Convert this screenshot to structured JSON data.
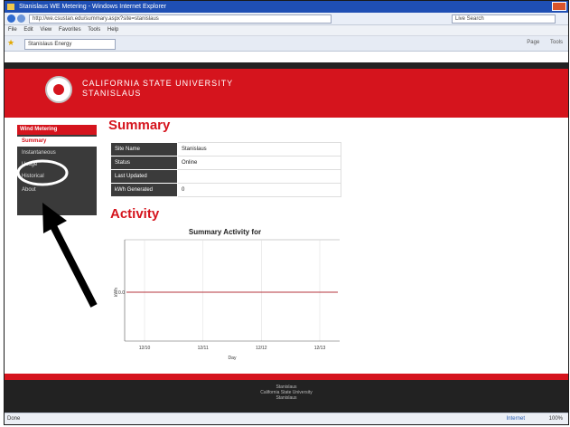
{
  "browser": {
    "title": "Stanislaus WE Metering - Windows Internet Explorer",
    "url": "http://we.csustan.edu/summary.aspx?site=stanislaus",
    "search_placeholder": "Live Search",
    "menu": [
      "File",
      "Edit",
      "View",
      "Favorites",
      "Tools",
      "Help"
    ],
    "tab_label": "Stanislaus Energy",
    "tools": [
      "Page",
      "Tools"
    ],
    "status_left": "Done",
    "status_zone": "Internet",
    "status_zoom": "100%"
  },
  "banner": {
    "line1": "CALIFORNIA STATE UNIVERSITY",
    "line2": "STANISLAUS"
  },
  "sidebar": {
    "header": "Wind Metering",
    "items": [
      {
        "label": "Summary",
        "active": true
      },
      {
        "label": "Instantaneous"
      },
      {
        "label": "Usage"
      },
      {
        "label": "Historical"
      },
      {
        "label": "About"
      }
    ]
  },
  "summary": {
    "heading": "Summary",
    "rows": [
      {
        "label": "Site Name",
        "value": "Stanislaus"
      },
      {
        "label": "Status",
        "value": "Online"
      },
      {
        "label": "Last Updated",
        "value": ""
      },
      {
        "label": "kWh Generated",
        "value": "0"
      }
    ]
  },
  "activity": {
    "heading": "Activity"
  },
  "chart_data": {
    "type": "line",
    "title": "Summary Activity for",
    "xlabel": "Day",
    "ylabel": "kWh",
    "categories": [
      "12/10",
      "12/11",
      "12/12",
      "12/13"
    ],
    "series": [
      {
        "values": [
          0,
          0,
          0,
          0
        ]
      }
    ],
    "ytick": "0.0",
    "line_color": "#b5343c",
    "grid": true
  },
  "footer": {
    "lines": [
      "Stanislaus",
      "California State University",
      "Stanislaus"
    ]
  },
  "colors": {
    "brand_red": "#d5141d",
    "dark": "#222222"
  }
}
